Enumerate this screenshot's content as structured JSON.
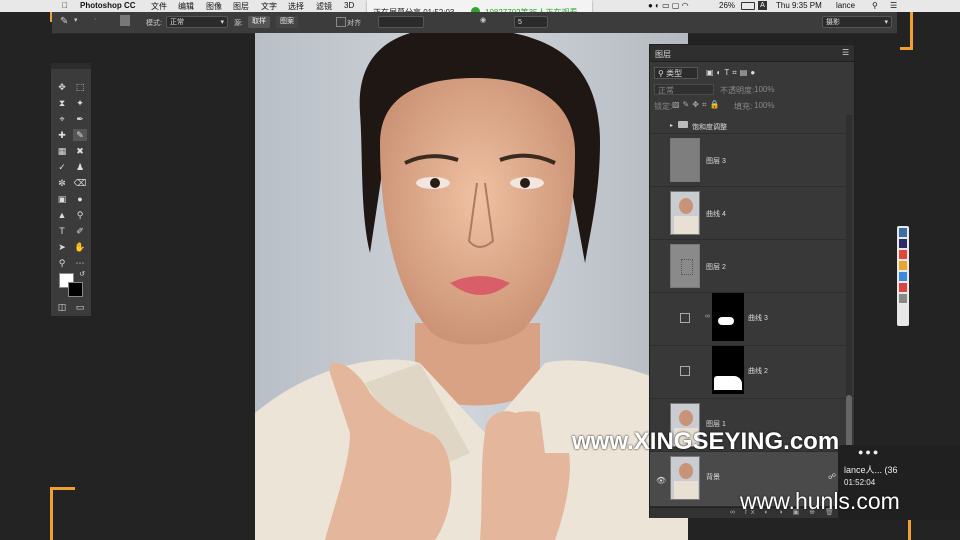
{
  "menubar": {
    "app": "Photoshop CC",
    "items": [
      "文件",
      "编辑",
      "图像",
      "图层",
      "文字",
      "选择",
      "滤镜",
      "3D"
    ],
    "battery": "26%",
    "clock": "Thu 9:35 PM",
    "user": "lance"
  },
  "share_bar": {
    "status": "正在屏幕分享 01:52:03",
    "viewers": "10827702等35人正在观看"
  },
  "options_bar": {
    "mode_label": "模式:",
    "mode_value": "正常",
    "source_label": "源:",
    "sample_button": "取样",
    "pattern_button": "图案",
    "align_label": "对齐",
    "diffusion_value": "5",
    "workspace": "摄影"
  },
  "layers_panel": {
    "title": "图层",
    "filter_kind": "类型",
    "blend_mode": "正常",
    "opacity_label": "不透明度:",
    "opacity_value": "100%",
    "lock_label": "锁定:",
    "fill_label": "填充:",
    "fill_value": "100%",
    "layers": [
      {
        "name": "饱和度调整",
        "kind": "group"
      },
      {
        "name": "图层 3",
        "kind": "gray"
      },
      {
        "name": "曲线 4",
        "kind": "photo"
      },
      {
        "name": "图层 2",
        "kind": "texture"
      },
      {
        "name": "曲线 3",
        "kind": "curve-mask"
      },
      {
        "name": "曲线 2",
        "kind": "curve-mask"
      },
      {
        "name": "图层 1",
        "kind": "photo"
      },
      {
        "name": "背景",
        "kind": "photo"
      }
    ]
  },
  "notification": {
    "title": "lance人... (36",
    "time": "01:52:04"
  },
  "watermarks": {
    "primary": "www.XINGSEYING.com",
    "secondary": "www.hunls.com"
  },
  "colors": {
    "accent_orange": "#f0a030",
    "panel_bg": "#383838",
    "menubar_bg": "#e8e8e8",
    "viewer_green": "#2aa52a"
  }
}
